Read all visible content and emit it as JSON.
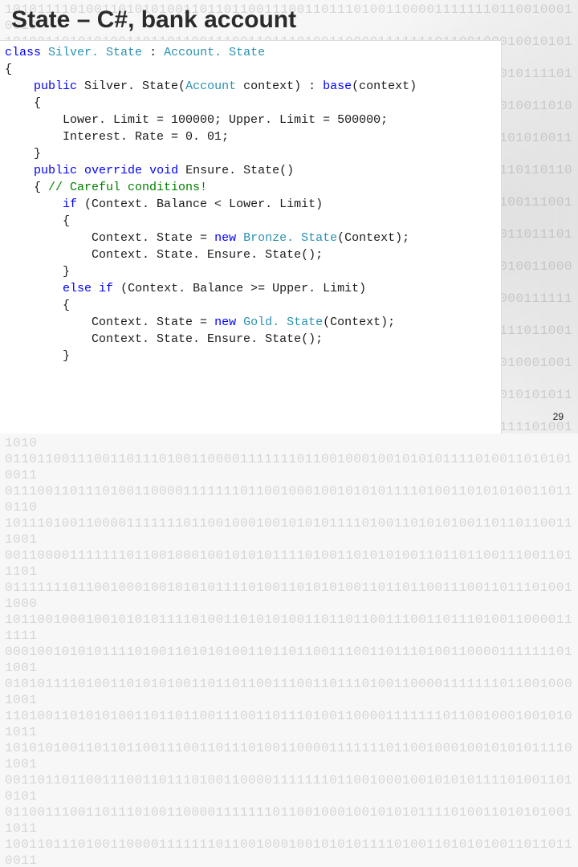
{
  "slide": {
    "title": "State – C#, bank account",
    "page_number": "29"
  },
  "code": {
    "tokens": [
      {
        "t": "kw",
        "v": "class"
      },
      {
        "t": "txt",
        "v": " "
      },
      {
        "t": "type",
        "v": "Silver. State"
      },
      {
        "t": "txt",
        "v": " : "
      },
      {
        "t": "type",
        "v": "Account. State"
      },
      {
        "t": "nl"
      },
      {
        "t": "txt",
        "v": "{"
      },
      {
        "t": "nl"
      },
      {
        "t": "ind",
        "n": 1
      },
      {
        "t": "kw",
        "v": "public"
      },
      {
        "t": "txt",
        "v": " Silver. State("
      },
      {
        "t": "type",
        "v": "Account"
      },
      {
        "t": "txt",
        "v": " context) : "
      },
      {
        "t": "kw",
        "v": "base"
      },
      {
        "t": "txt",
        "v": "(context)"
      },
      {
        "t": "nl"
      },
      {
        "t": "ind",
        "n": 1
      },
      {
        "t": "txt",
        "v": "{"
      },
      {
        "t": "nl"
      },
      {
        "t": "ind",
        "n": 2
      },
      {
        "t": "txt",
        "v": "Lower. Limit = 100000; Upper. Limit = 500000;"
      },
      {
        "t": "nl"
      },
      {
        "t": "ind",
        "n": 2
      },
      {
        "t": "txt",
        "v": "Interest. Rate = 0. 01;"
      },
      {
        "t": "nl"
      },
      {
        "t": "ind",
        "n": 1
      },
      {
        "t": "txt",
        "v": "}"
      },
      {
        "t": "nl"
      },
      {
        "t": "ind",
        "n": 1
      },
      {
        "t": "kw",
        "v": "public"
      },
      {
        "t": "txt",
        "v": " "
      },
      {
        "t": "kw",
        "v": "override"
      },
      {
        "t": "txt",
        "v": " "
      },
      {
        "t": "kw",
        "v": "void"
      },
      {
        "t": "txt",
        "v": " Ensure. State()"
      },
      {
        "t": "nl"
      },
      {
        "t": "ind",
        "n": 1
      },
      {
        "t": "txt",
        "v": "{ "
      },
      {
        "t": "comm",
        "v": "// Careful conditions!"
      },
      {
        "t": "nl"
      },
      {
        "t": "ind",
        "n": 2
      },
      {
        "t": "kw",
        "v": "if"
      },
      {
        "t": "txt",
        "v": " (Context. Balance < Lower. Limit)"
      },
      {
        "t": "nl"
      },
      {
        "t": "ind",
        "n": 2
      },
      {
        "t": "txt",
        "v": "{"
      },
      {
        "t": "nl"
      },
      {
        "t": "ind",
        "n": 3
      },
      {
        "t": "txt",
        "v": "Context. State = "
      },
      {
        "t": "kw",
        "v": "new"
      },
      {
        "t": "txt",
        "v": " "
      },
      {
        "t": "type",
        "v": "Bronze. State"
      },
      {
        "t": "txt",
        "v": "(Context);"
      },
      {
        "t": "nl"
      },
      {
        "t": "ind",
        "n": 3
      },
      {
        "t": "txt",
        "v": "Context. State. Ensure. State();"
      },
      {
        "t": "nl"
      },
      {
        "t": "ind",
        "n": 2
      },
      {
        "t": "txt",
        "v": "}"
      },
      {
        "t": "nl"
      },
      {
        "t": "ind",
        "n": 2
      },
      {
        "t": "kw",
        "v": "else"
      },
      {
        "t": "txt",
        "v": " "
      },
      {
        "t": "kw",
        "v": "if"
      },
      {
        "t": "txt",
        "v": " (Context. Balance >= Upper. Limit)"
      },
      {
        "t": "nl"
      },
      {
        "t": "ind",
        "n": 2
      },
      {
        "t": "txt",
        "v": "{"
      },
      {
        "t": "nl"
      },
      {
        "t": "ind",
        "n": 3
      },
      {
        "t": "txt",
        "v": "Context. State = "
      },
      {
        "t": "kw",
        "v": "new"
      },
      {
        "t": "txt",
        "v": " "
      },
      {
        "t": "type",
        "v": "Gold. State"
      },
      {
        "t": "txt",
        "v": "(Context);"
      },
      {
        "t": "nl"
      },
      {
        "t": "ind",
        "n": 3
      },
      {
        "t": "txt",
        "v": "Context. State. Ensure. State();"
      },
      {
        "t": "nl"
      },
      {
        "t": "ind",
        "n": 2
      },
      {
        "t": "txt",
        "v": "}"
      }
    ],
    "indent_unit": "    "
  },
  "background": {
    "binary_row": "10101111010011010101001101101100111001101110100110000111111101100100010010",
    "rows": 27
  }
}
